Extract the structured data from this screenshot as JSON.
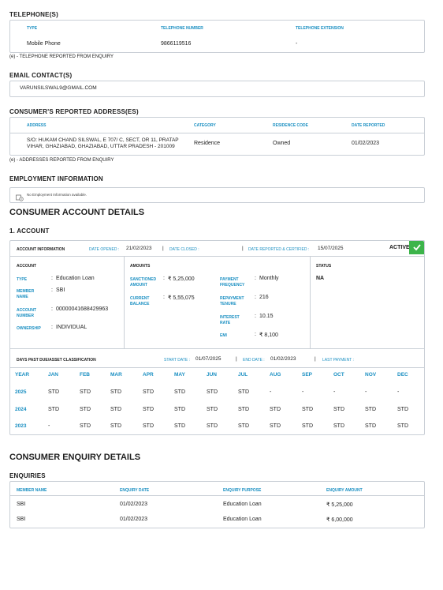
{
  "telephones": {
    "title": "TELEPHONE(S)",
    "headers": [
      "TYPE",
      "TELEPHONE NUMBER",
      "TELEPHONE EXTENSION"
    ],
    "rows": [
      [
        "Mobile Phone",
        "9866119516",
        "-"
      ]
    ],
    "note": "(e) - TELEPHONE REPORTED FROM ENQUIRY"
  },
  "email": {
    "title": "EMAIL CONTACT(S)",
    "value": "VARUNSILSWAL9@GMAIL.COM"
  },
  "address": {
    "title": "CONSUMER'S REPORTED ADDRESS(ES)",
    "headers": [
      "ADDRESS",
      "CATEGORY",
      "RESIDENCE CODE",
      "DATE REPORTED"
    ],
    "rows": [
      {
        "address_line1": "S/O: HUKAM CHAND SILSWAL, E 707/ C, SECT, OR 11, PRATAP",
        "address_line2": "VIHAR, GHAZIABAD, GHAZIABAD, UTTAR PRADESH - 201009",
        "category": "Residence",
        "residence_code": "Owned",
        "date_reported": "01/02/2023"
      }
    ],
    "note": "(e) - ADDRESSES REPORTED FROM ENQUIRY"
  },
  "employment": {
    "title": "EMPLOYMENT INFORMATION",
    "icon": "document-info-icon",
    "message": "No Employment Information available."
  },
  "account_details": {
    "title": "CONSUMER ACCOUNT DETAILS",
    "subtitle": "1. ACCOUNT",
    "header": {
      "label": "ACCOUNT INFORMATION",
      "date_opened_label": "DATE OPENED :",
      "date_opened": "21/02/2023",
      "date_closed_label": "DATE CLOSED :",
      "date_closed": "",
      "date_reported_label": "DATE REPORTED & CERTIFIED :",
      "date_reported": "15/07/2025",
      "status_badge": "ACTIVE",
      "sep": "|"
    },
    "account_col": {
      "title": "ACCOUNT",
      "type_label": "TYPE",
      "type": "Education Loan",
      "member_label": "MEMBER NAME",
      "member": "SBI",
      "number_label": "ACCOUNT NUMBER",
      "number": "00000041688429963",
      "ownership_label": "OWNERSHIP",
      "ownership": "INDIVIDUAL"
    },
    "amounts_col": {
      "title": "AMOUNTS",
      "sanctioned_label": "SANCTIONED AMOUNT",
      "sanctioned": "₹ 5,25,000",
      "current_label": "CURRENT BALANCE",
      "current": "₹ 5,55,075",
      "freq_label": "PAYMENT FREQUENCY",
      "freq": "Monthly",
      "tenure_label": "REPAYMENT TENURE",
      "tenure": "216",
      "rate_label": "INTEREST RATE",
      "rate": "10.15",
      "emi_label": "EMI",
      "emi": "₹ 8,100"
    },
    "status_col": {
      "title": "STATUS",
      "value": "NA"
    },
    "dpd": {
      "label": "DAYS PAST DUE/ASSET CLASSIFICATION",
      "start_label": "START DATE :",
      "start": "01/07/2025",
      "end_label": "END DATE :",
      "end": "01/02/2023",
      "last_payment_label": "LAST PAYMENT :",
      "last_payment": "",
      "headers": [
        "YEAR",
        "JAN",
        "FEB",
        "MAR",
        "APR",
        "MAY",
        "JUN",
        "JUL",
        "AUG",
        "SEP",
        "OCT",
        "NOV",
        "DEC"
      ],
      "rows": [
        [
          "2025",
          "STD",
          "STD",
          "STD",
          "STD",
          "STD",
          "STD",
          "STD",
          "-",
          "-",
          "-",
          "-",
          "-"
        ],
        [
          "2024",
          "STD",
          "STD",
          "STD",
          "STD",
          "STD",
          "STD",
          "STD",
          "STD",
          "STD",
          "STD",
          "STD",
          "STD"
        ],
        [
          "2023",
          "-",
          "STD",
          "STD",
          "STD",
          "STD",
          "STD",
          "STD",
          "STD",
          "STD",
          "STD",
          "STD",
          "STD"
        ]
      ]
    }
  },
  "enquiry": {
    "title": "CONSUMER ENQUIRY DETAILS",
    "subtitle": "ENQUIRIES",
    "headers": [
      "MEMBER NAME",
      "ENQUIRY DATE",
      "ENQUIRY PURPOSE",
      "ENQUIRY AMOUNT"
    ],
    "rows": [
      [
        "SBI",
        "01/02/2023",
        "Education Loan",
        "₹ 5,25,000"
      ],
      [
        "SBI",
        "01/02/2023",
        "Education Loan",
        "₹ 6,00,000"
      ]
    ]
  },
  "colors": {
    "accent": "#1a8fc2",
    "border": "#c9cfd6",
    "active_badge": "#3cb44a"
  }
}
